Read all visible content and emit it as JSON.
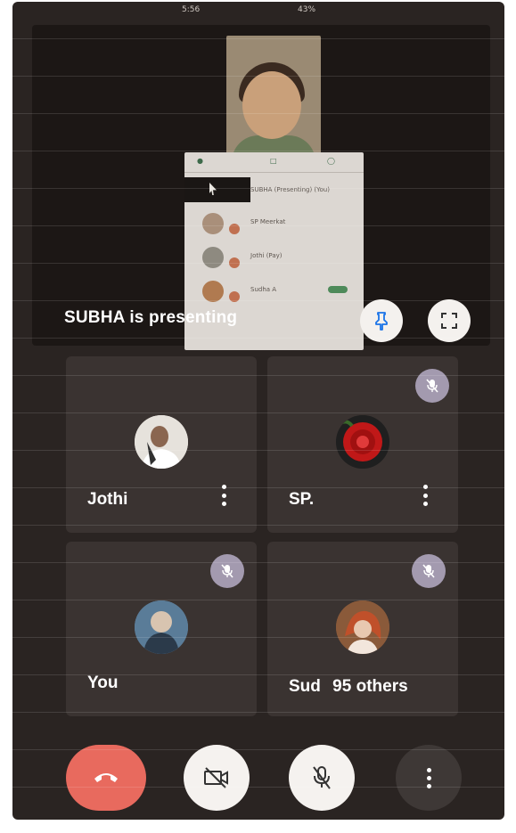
{
  "status_bar": {
    "time": "5:56",
    "right_status": "43%"
  },
  "presentation": {
    "label": "SUBHA is presenting",
    "doc_rows": [
      {
        "name": "SUBHA (Presenting) (You)"
      },
      {
        "name": "SP Meerkat"
      },
      {
        "name": "Jothi (Pay)"
      },
      {
        "name": "Sudha A"
      }
    ]
  },
  "tiles": [
    {
      "name": "Jothi",
      "muted": false
    },
    {
      "name": "SP.",
      "muted": true
    },
    {
      "name": "You",
      "muted": true
    },
    {
      "name": "Sud",
      "muted": true,
      "others_text": "95 others"
    }
  ],
  "icons": {
    "pin": "pin-icon",
    "fullscreen": "fullscreen-icon",
    "mic_off": "mic-off-icon",
    "more": "more-vert-icon",
    "end_call": "end-call-icon",
    "camera_off": "camera-off-icon"
  },
  "colors": {
    "end_call": "#e86a5e",
    "tile_bg": "#3a3331",
    "mute_badge": "#a39aaf",
    "background": "#2a2422"
  }
}
